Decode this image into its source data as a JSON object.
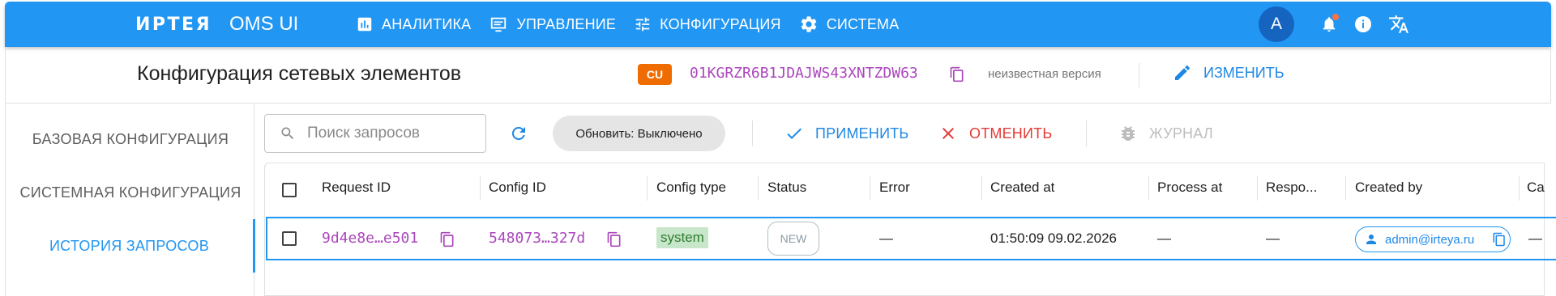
{
  "app": {
    "logo": "ИРТЕЯ",
    "name": "OMS UI",
    "nav": [
      {
        "label": "АНАЛИТИКА",
        "icon": "analytics-icon"
      },
      {
        "label": "УПРАВЛЕНИЕ",
        "icon": "monitor-icon"
      },
      {
        "label": "КОНФИГУРАЦИЯ",
        "icon": "tune-icon"
      },
      {
        "label": "СИСТЕМА",
        "icon": "gear-icon"
      }
    ],
    "avatar_letter": "A",
    "notification_dot_color": "#ff7043",
    "accent_color": "#2196f3"
  },
  "page": {
    "title": "Конфигурация сетевых элементов",
    "element_type_badge": "CU",
    "element_id": "01KGRZR6B1JDAJWS43XNTZDW63",
    "version": "неизвестная версия",
    "edit_label": "ИЗМЕНИТЬ"
  },
  "sidebar": {
    "items": [
      {
        "label": "БАЗОВАЯ КОНФИГУРАЦИЯ",
        "active": false
      },
      {
        "label": "СИСТЕМНАЯ КОНФИГУРАЦИЯ",
        "active": false
      },
      {
        "label": "ИСТОРИЯ ЗАПРОСОВ",
        "active": true
      }
    ]
  },
  "toolbar": {
    "search_placeholder": "Поиск запросов",
    "auto_refresh_label": "Обновить: Выключено",
    "apply_label": "ПРИМЕНИТЬ",
    "cancel_label": "ОТМЕНИТЬ",
    "journal_label": "ЖУРНАЛ"
  },
  "table": {
    "columns": [
      "Request ID",
      "Config ID",
      "Config type",
      "Status",
      "Error",
      "Created at",
      "Process at",
      "Respo...",
      "Created by",
      "Ca"
    ],
    "rows": [
      {
        "request_id": "9d4e8e…e501",
        "config_id": "548073…327d",
        "config_type": "system",
        "status": "NEW",
        "error": "—",
        "created_at": "01:50:09 09.02.2026",
        "process_at": "—",
        "response": "—",
        "created_by": "admin@irteya.ru",
        "extra": "—"
      }
    ]
  }
}
